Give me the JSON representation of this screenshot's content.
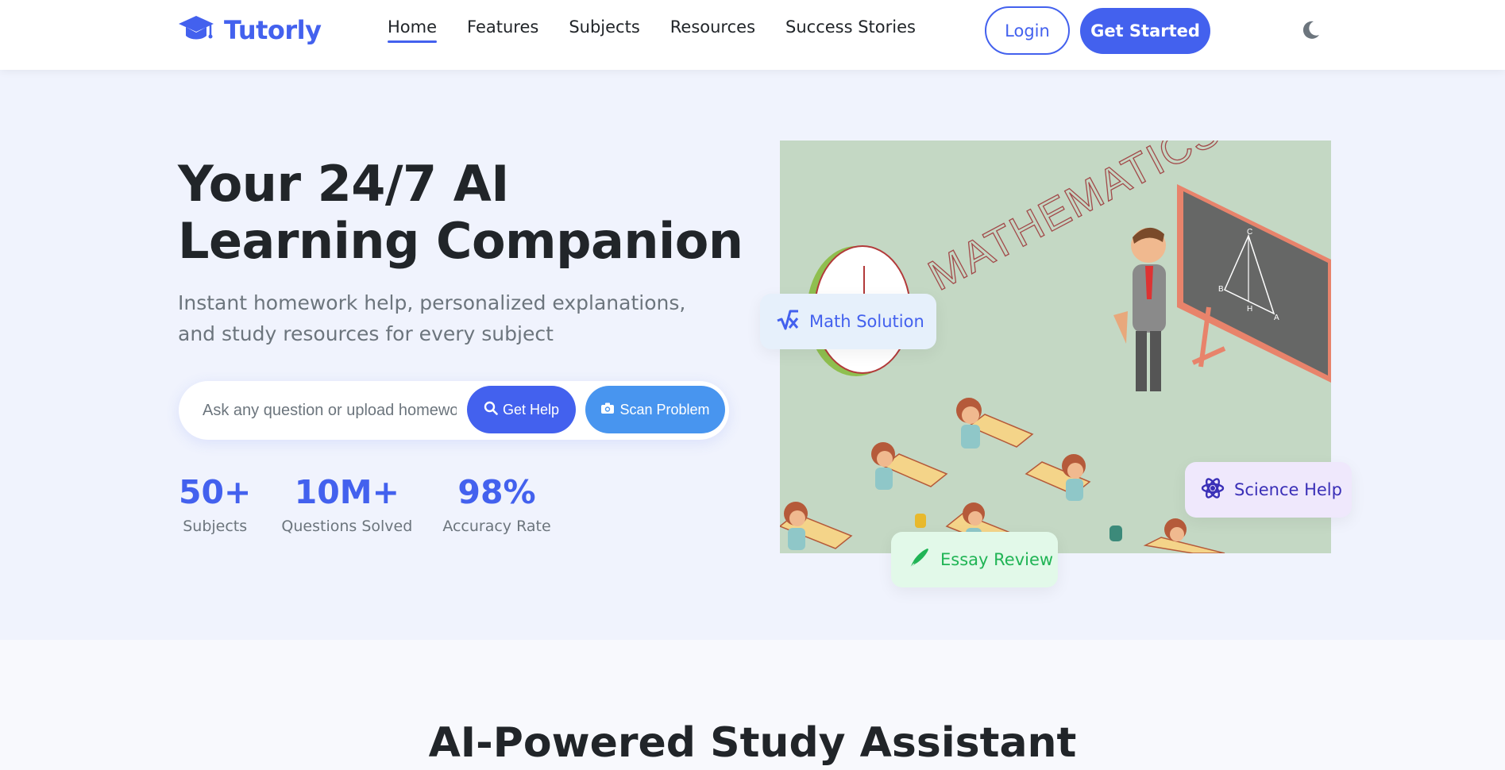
{
  "brand": {
    "name": "Tutorly",
    "accent": "#4361ee",
    "icon": "graduation-cap-icon"
  },
  "nav": {
    "links": [
      {
        "label": "Home",
        "active": true
      },
      {
        "label": "Features"
      },
      {
        "label": "Subjects"
      },
      {
        "label": "Resources"
      },
      {
        "label": "Success Stories"
      }
    ],
    "login_label": "Login",
    "get_started_label": "Get Started",
    "theme_icon": "moon-icon"
  },
  "hero": {
    "title": "Your 24/7 AI Learning Companion",
    "subtitle": "Instant homework help, personalized explanations, and study resources for every subject",
    "search": {
      "placeholder": "Ask any question or upload homework",
      "help_label": "Get Help",
      "scan_label": "Scan Problem"
    },
    "stats": [
      {
        "value": "50+",
        "label": "Subjects"
      },
      {
        "value": "10M+",
        "label": "Questions Solved"
      },
      {
        "value": "98%",
        "label": "Accuracy Rate"
      }
    ],
    "illustration": {
      "board_word": "MATHEMATICS",
      "triangle_labels": [
        "C",
        "B",
        "H",
        "A"
      ]
    },
    "chips": {
      "math": "Math Solution",
      "science": "Science Help",
      "essay": "Essay Review"
    }
  },
  "section2": {
    "title": "AI-Powered Study Assistant"
  },
  "colors": {
    "primary": "#4361ee",
    "secondary": "#4895ef",
    "hero_bg": "#f0f3fd",
    "essay_green": "#20b455",
    "science_purple": "#3a2fb7"
  }
}
